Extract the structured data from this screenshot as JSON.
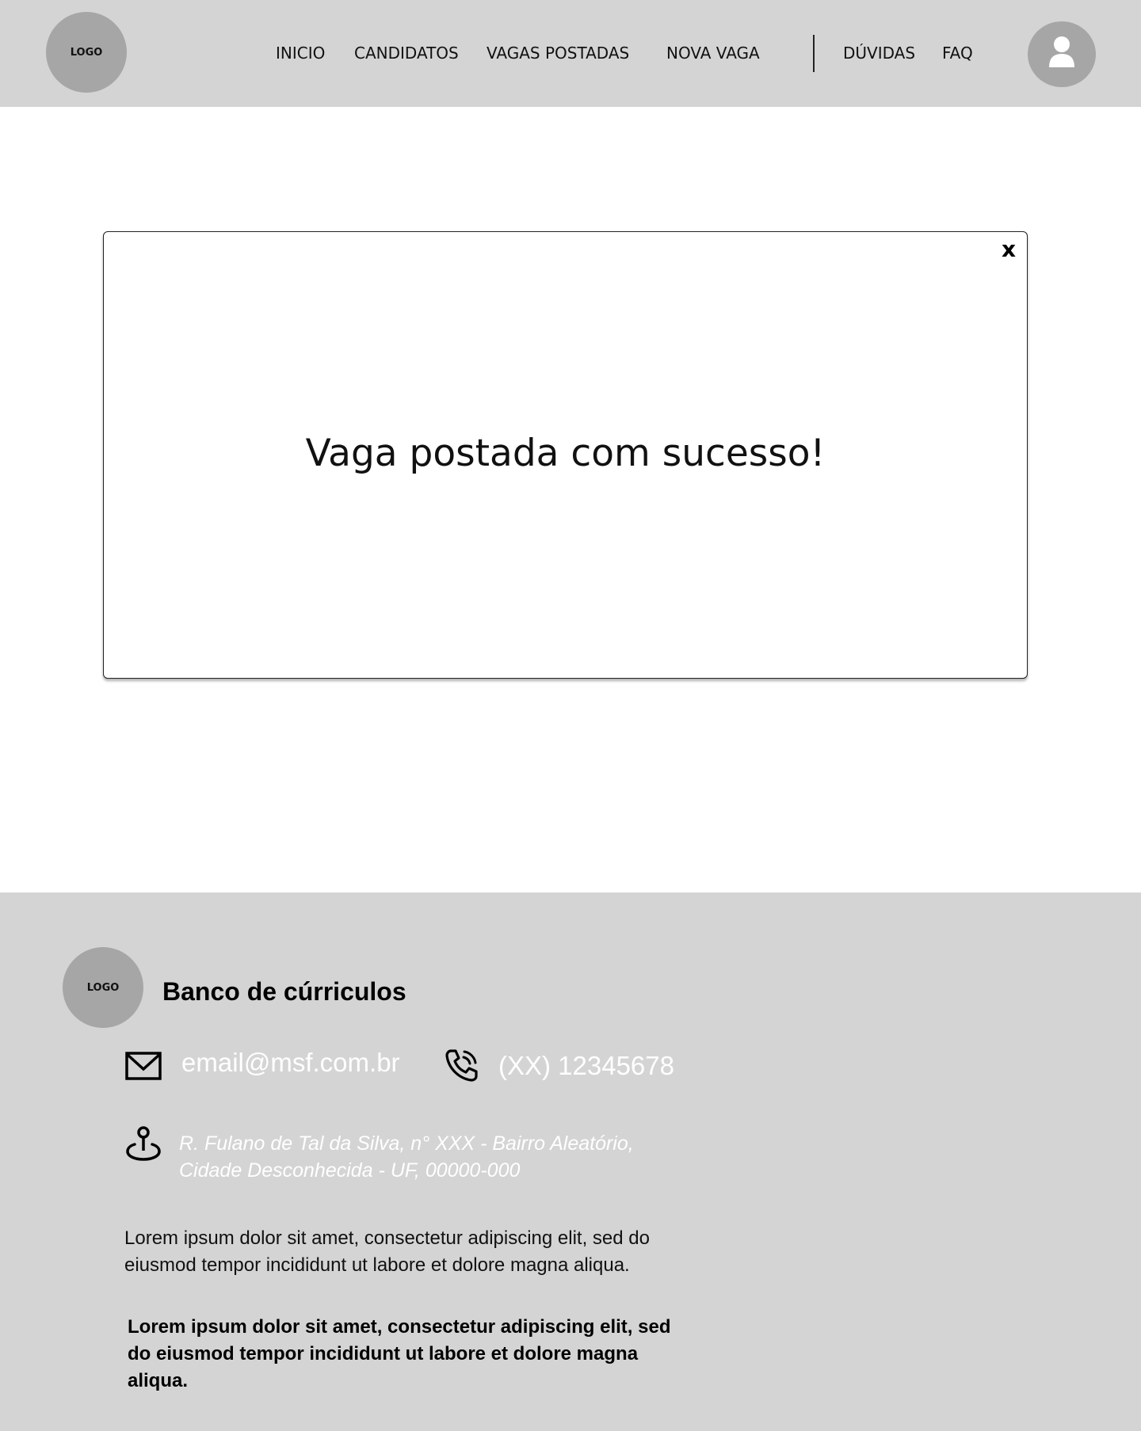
{
  "header": {
    "logo_text": "LOGO",
    "nav": [
      {
        "label": "INICIO"
      },
      {
        "label": "CANDIDATOS"
      },
      {
        "label": "VAGAS POSTADAS"
      },
      {
        "label": "NOVA VAGA"
      },
      {
        "label": "DÚVIDAS"
      },
      {
        "label": "FAQ"
      }
    ],
    "avatar_icon": "user-icon"
  },
  "modal": {
    "close_label": "x",
    "message": "Vaga postada com sucesso!"
  },
  "footer": {
    "logo_text": "LOGO",
    "title": "Banco de cúrriculos",
    "email": "email@msf.com.br",
    "phone": "(XX) 12345678",
    "address_line1": "R. Fulano de Tal da Silva, n° XXX - Bairro Aleatório,",
    "address_line2": "Cidade Desconhecida - UF, 00000-000",
    "paragraph": "Lorem ipsum dolor sit amet, consectetur adipiscing elit, sed do eiusmod tempor incididunt ut labore et dolore magna aliqua.",
    "paragraph_bold": "Lorem ipsum dolor sit amet, consectetur adipiscing elit, sed do eiusmod tempor incididunt ut labore et dolore magna aliqua.",
    "icons": [
      "mail-icon",
      "phone-icon",
      "location-pin-icon"
    ]
  },
  "colors": {
    "bar_background": "#d4d4d4",
    "circle_gray": "#a6a6a6",
    "contact_text": "#ffffff"
  }
}
